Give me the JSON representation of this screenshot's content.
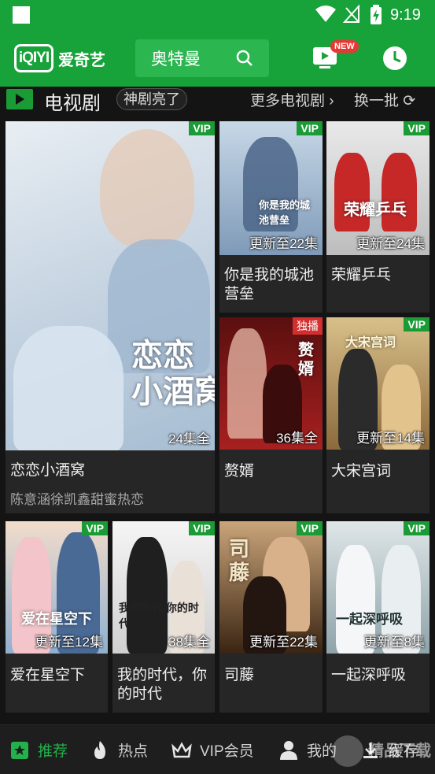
{
  "status": {
    "time": "9:19"
  },
  "appbar": {
    "logo_mark": "iQIYI",
    "logo_text": "爱奇艺",
    "search_query": "奥特曼",
    "new_badge": "NEW"
  },
  "section": {
    "title": "电视剧",
    "tag": "神剧亮了",
    "more": "更多电视剧 ›",
    "refresh": "换一批 ⟳"
  },
  "cards": [
    {
      "title": "恋恋小酒窝",
      "subtitle": "陈意涵徐凯鑫甜蜜热恋",
      "badge": "VIP",
      "episodes": "24集全",
      "poster_text": "恋恋\n小酒窝",
      "poster_color": "#c9d6e3"
    },
    {
      "title": "你是我的城池营垒",
      "badge": "VIP",
      "episodes": "更新至22集",
      "poster_text": "你是我的城池营垒",
      "poster_color": "#a9c0d6"
    },
    {
      "title": "荣耀乒乓",
      "badge": "VIP",
      "episodes": "更新至24集",
      "poster_text": "荣耀乒乓",
      "poster_color": "#b23a3a"
    },
    {
      "title": "赘婿",
      "badge": "独播",
      "episodes": "36集全",
      "poster_text": "赘婿",
      "poster_color": "#8a1d1d"
    },
    {
      "title": "大宋宫词",
      "badge": "VIP",
      "episodes": "更新至14集",
      "poster_text": "大宋宫词",
      "poster_color": "#b89460"
    },
    {
      "title": "爱在星空下",
      "badge": "VIP",
      "episodes": "更新至12集",
      "poster_text": "爱在星空下",
      "poster_color": "#d7b8a8"
    },
    {
      "title": "我的时代，你的时代",
      "badge": "VIP",
      "episodes": "38集全",
      "poster_text": "我的时代 你的时代",
      "poster_color": "#cfcfcf"
    },
    {
      "title": "司藤",
      "badge": "VIP",
      "episodes": "更新至22集",
      "poster_text": "司藤",
      "poster_color": "#6b4a2a"
    },
    {
      "title": "一起深呼吸",
      "badge": "VIP",
      "episodes": "更新至8集",
      "poster_text": "一起深呼吸",
      "poster_color": "#9fb2b8"
    }
  ],
  "nav": [
    {
      "label": "推荐",
      "icon": "star-icon",
      "active": true
    },
    {
      "label": "热点",
      "icon": "flame-icon",
      "active": false
    },
    {
      "label": "VIP会员",
      "icon": "crown-icon",
      "active": false
    },
    {
      "label": "我的",
      "icon": "person-icon",
      "active": false
    },
    {
      "label": "缓存",
      "icon": "download-icon",
      "active": false
    }
  ],
  "watermark": "精品下载"
}
